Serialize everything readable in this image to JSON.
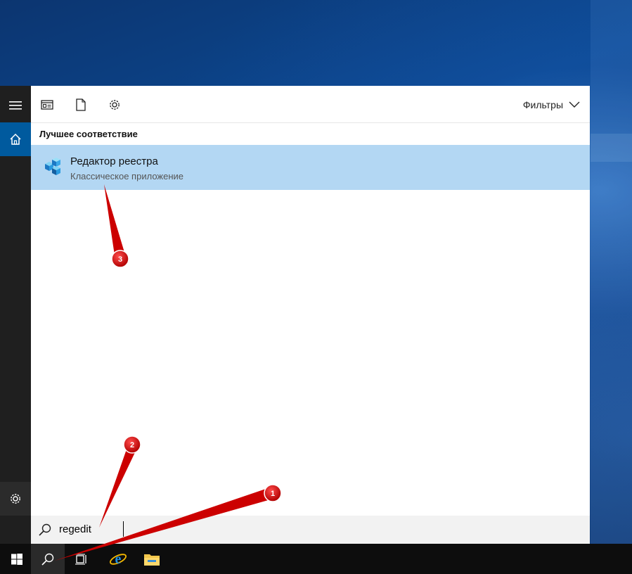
{
  "start_panel": {
    "filters_label": "Фильтры",
    "best_match_heading": "Лучшее соответствие",
    "result": {
      "title": "Редактор реестра",
      "subtitle": "Классическое приложение",
      "icon": "registry-editor-icon"
    },
    "header_icons": [
      "apps-icon",
      "documents-icon",
      "settings-icon"
    ]
  },
  "rail": {
    "items": [
      "hamburger-menu-icon",
      "home-icon",
      "settings-icon"
    ]
  },
  "search": {
    "value": "regedit"
  },
  "taskbar": {
    "items": [
      "windows-start-icon",
      "search-icon",
      "task-view-icon",
      "internet-explorer-icon",
      "file-explorer-icon"
    ]
  },
  "annotations": {
    "markers": [
      "1",
      "2",
      "3"
    ],
    "color": "#cc0000"
  },
  "colors": {
    "rail_bg": "#1f1f1f",
    "home_accent": "#005a9e",
    "selected_row": "#b3d7f3",
    "searchbar_bg": "#f2f2f2",
    "taskbar_bg": "#0d0d0d"
  }
}
